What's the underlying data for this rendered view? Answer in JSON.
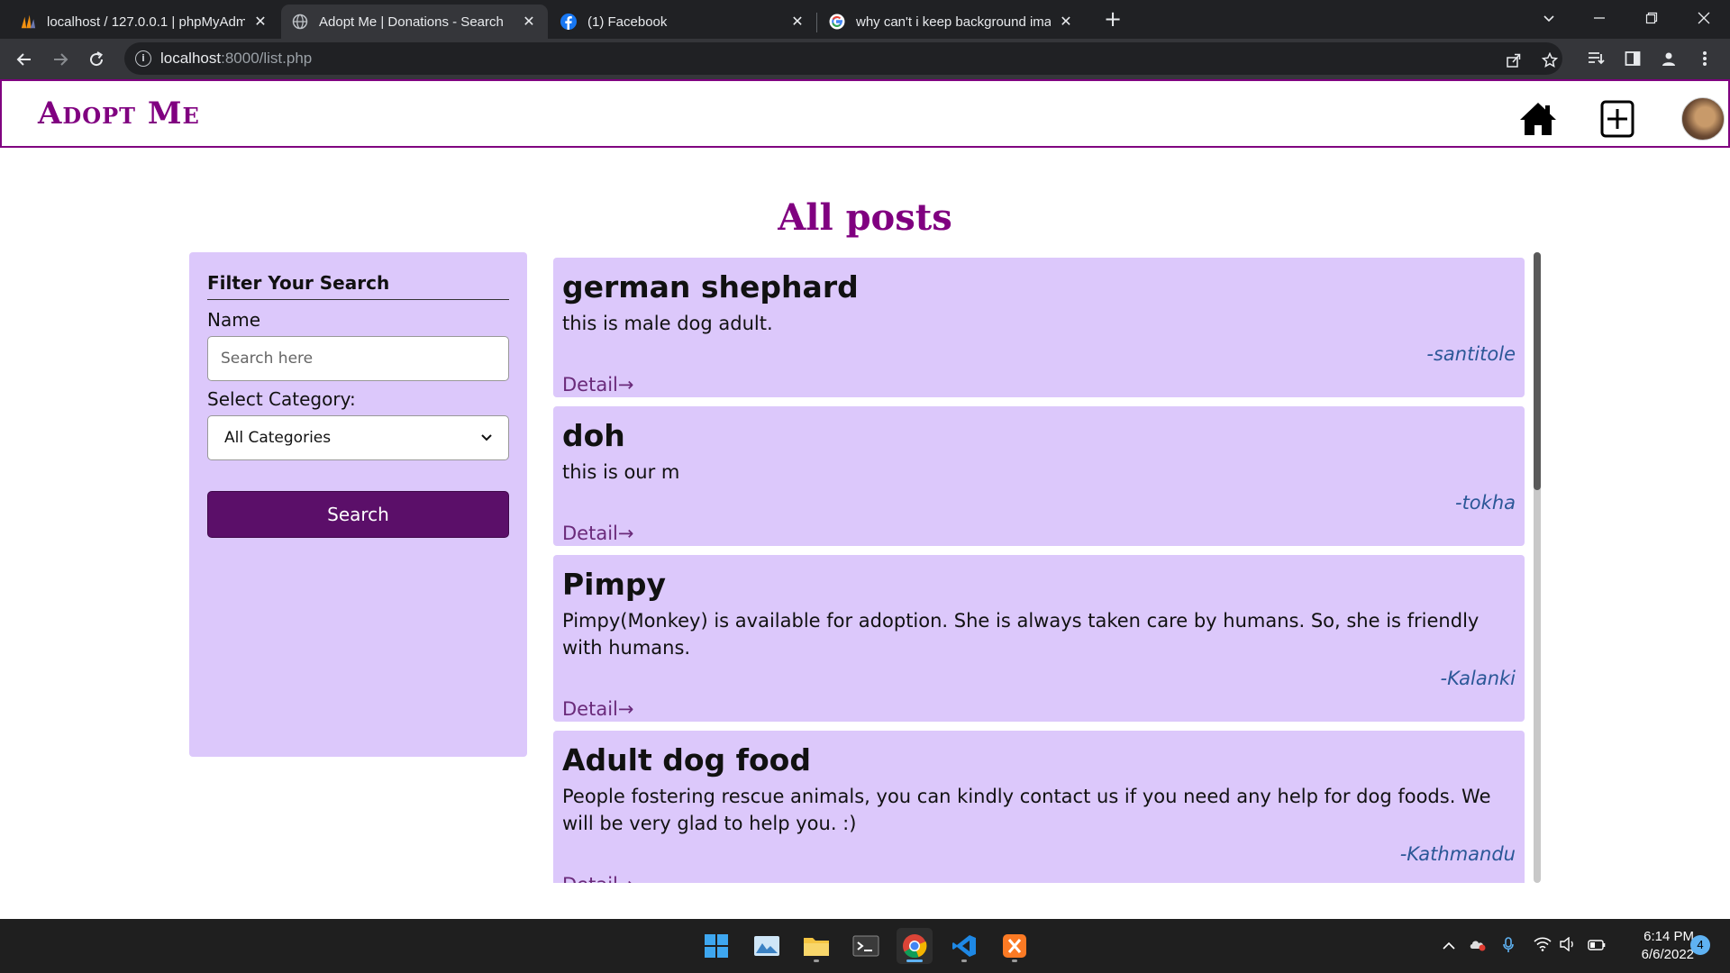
{
  "browser": {
    "tabs": [
      {
        "label": "localhost / 127.0.0.1 | phpMyAdm",
        "icon": "phpmyadmin-icon",
        "active": false
      },
      {
        "label": "Adopt Me | Donations - Search",
        "icon": "globe-icon",
        "active": true
      },
      {
        "label": "(1) Facebook",
        "icon": "facebook-icon",
        "active": false
      },
      {
        "label": "why can't i keep background ima",
        "icon": "google-icon",
        "active": false
      }
    ],
    "close_glyph": "✕",
    "new_tab_glyph": "+",
    "url_host": "localhost",
    "url_rest": ":8000/list.php"
  },
  "site": {
    "brand": "Adopt Me",
    "page_title": "All posts",
    "accent_color": "#800080"
  },
  "filter": {
    "heading": "Filter Your Search",
    "name_label": "Name",
    "name_placeholder": "Search here",
    "category_label": "Select Category:",
    "category_selected": "All Categories",
    "search_button": "Search"
  },
  "posts": [
    {
      "title": "german shephard",
      "description": "this is male dog adult.",
      "author": "-santitole",
      "detail": "Detail→"
    },
    {
      "title": "doh",
      "description": "this is our m",
      "author": "-tokha",
      "detail": "Detail→"
    },
    {
      "title": "Pimpy",
      "description": "Pimpy(Monkey) is available for adoption. She is always taken care by humans. So, she is friendly with humans.",
      "author": "-Kalanki",
      "detail": "Detail→"
    },
    {
      "title": "Adult dog food",
      "description": "People fostering rescue animals, you can kindly contact us if you need any help for dog foods. We will be very glad to help you. :)",
      "author": "-Kathmandu",
      "detail": "Detail→"
    }
  ],
  "taskbar": {
    "time": "6:14 PM",
    "date": "6/6/2022",
    "notifications": "4"
  }
}
